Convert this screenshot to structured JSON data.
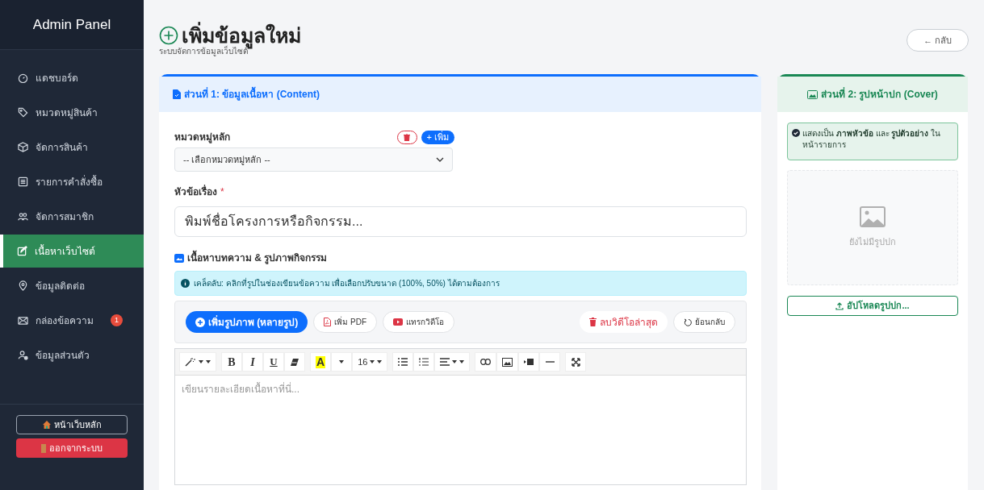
{
  "sidebar": {
    "title": "Admin Panel",
    "items": [
      {
        "label": "แดชบอร์ด",
        "selected": false
      },
      {
        "label": "หมวดหมู่สินค้า",
        "selected": false
      },
      {
        "label": "จัดการสินค้า",
        "selected": false
      },
      {
        "label": "รายการคำสั่งซื้อ",
        "selected": false
      },
      {
        "label": "จัดการสมาชิก",
        "selected": false
      },
      {
        "label": "เนื้อหาเว็บไซต์",
        "selected": true
      },
      {
        "label": "ข้อมูลติดต่อ",
        "selected": false
      },
      {
        "label": "กล่องข้อความ",
        "selected": false,
        "badge": "1"
      },
      {
        "label": "ข้อมูลส่วนตัว",
        "selected": false
      }
    ],
    "home_button": "หน้าเว็บหลัก",
    "logout_button": "ออกจากระบบ"
  },
  "header": {
    "title": "เพิ่มข้อมูลใหม่",
    "subtitle": "ระบบจัดการข้อมูลเว็บไซต์",
    "back_button": "← กลับ"
  },
  "content_card": {
    "title": "ส่วนที่ 1: ข้อมูลเนื้อหา (Content)",
    "category": {
      "label": "หมวดหมู่หลัก",
      "add_button": "+ เพิ่ม",
      "select_value": "-- เลือกหมวดหมู่หลัก --"
    },
    "topic": {
      "label": "หัวข้อเรื่อง",
      "required_mark": "*",
      "placeholder": "พิมพ์ชื่อโครงการหรือกิจกรรม..."
    },
    "body_label": "เนื้อหาบทความ & รูปภาพกิจกรรม",
    "tip": "เคล็ดลับ: คลิกที่รูปในช่องเขียนข้อความ เพื่อเลือกปรับขนาด (100%, 50%) ได้ตามต้องการ",
    "media_buttons": [
      {
        "kind": "primary",
        "label": "เพิ่มรูปภาพ (หลายรูป)"
      },
      {
        "kind": "pdf",
        "label": "เพิ่ม PDF"
      },
      {
        "kind": "video",
        "label": "แทรกวิดีโอ"
      },
      {
        "kind": "delete",
        "label": "ลบวิดีโอล่าสุด"
      },
      {
        "kind": "undo",
        "label": "ย้อนกลับ"
      }
    ],
    "toolbar": [
      [
        {
          "kind": "magic"
        }
      ],
      [
        {
          "kind": "bold",
          "label": "B"
        },
        {
          "kind": "italic",
          "label": "I"
        },
        {
          "kind": "underline",
          "label": "U"
        },
        {
          "kind": "eraser"
        }
      ],
      [
        {
          "kind": "color",
          "label": "A"
        },
        {
          "kind": "caret"
        },
        {
          "kind": "size",
          "label": "16"
        }
      ],
      [
        {
          "kind": "ul"
        },
        {
          "kind": "ol"
        },
        {
          "kind": "align"
        }
      ],
      [
        {
          "kind": "link"
        },
        {
          "kind": "image"
        },
        {
          "kind": "video"
        },
        {
          "kind": "hr"
        }
      ],
      [
        {
          "kind": "fullscreen"
        }
      ]
    ],
    "editor_placeholder": "เขียนรายละเอียดเนื้อหาที่นี่..."
  },
  "cover_card": {
    "title": "ส่วนที่ 2: รูปหน้าปก (Cover)",
    "note": "แสดงเป็น **ภาพหัวข้อ** และ **รูปตัวอย่าง** ในหน้ารายการ",
    "empty_text": "ยังไม่มีรูปปก",
    "upload_button": "อัปโหลดรูปปก..."
  }
}
